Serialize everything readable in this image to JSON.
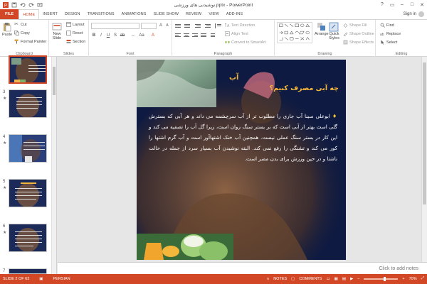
{
  "window": {
    "title": "نوشیدنی های ورزشی.pptx - PowerPoint",
    "signin": "Sign in"
  },
  "tabs": [
    "FILE",
    "HOME",
    "INSERT",
    "DESIGN",
    "TRANSITIONS",
    "ANIMATIONS",
    "SLIDE SHOW",
    "REVIEW",
    "VIEW",
    "ADD-INS"
  ],
  "ribbon": {
    "clipboard": {
      "label": "Clipboard",
      "paste": "Paste",
      "cut": "Cut",
      "copy": "Copy",
      "format_painter": "Format Painter"
    },
    "slides": {
      "label": "Slides",
      "new_slide_1": "New",
      "new_slide_2": "Slide",
      "layout": "Layout",
      "reset": "Reset",
      "section": "Section"
    },
    "font": {
      "label": "Font"
    },
    "paragraph": {
      "label": "Paragraph",
      "text_direction": "Text Direction",
      "align_text": "Align Text",
      "convert_smartart": "Convert to SmartArt"
    },
    "drawing": {
      "label": "Drawing",
      "arrange": "Arrange",
      "quick_styles_1": "Quick",
      "quick_styles_2": "Styles",
      "shape_fill": "Shape Fill",
      "shape_outline": "Shape Outline",
      "shape_effects": "Shape Effects"
    },
    "editing": {
      "label": "Editing",
      "find": "Find",
      "replace": "Replace",
      "select": "Select"
    }
  },
  "thumbnails": [
    {
      "num": "",
      "selected": true
    },
    {
      "num": "3",
      "selected": false
    },
    {
      "num": "4",
      "selected": false
    },
    {
      "num": "5",
      "selected": false
    },
    {
      "num": "6",
      "selected": false
    },
    {
      "num": "7",
      "selected": false
    }
  ],
  "slide": {
    "heading": "آب",
    "title": "چه آبی مصرف کنیم؟",
    "body": "ابوعلی سینا آب جاری را مطلوب تر از آب سرچشمه می داند و هر آبی که بسترش گلی است بهتر از آبی است که بر بستر سنگ روان است، زیرا گل آب را تصفیه می کند و این کار در بستر سنگ عملی نیست. همچنین آب خنک اشتهاآور است و آب گرم اشتها را کور می کند و تشنگی را رفع نمی کند. البته نوشیدن آب بسیار سرد از جمله در حالت ناشتا و در حین ورزش برای بدن مضر است."
  },
  "notes": {
    "placeholder": "Click to add notes"
  },
  "status": {
    "slide": "SLIDE 2 OF 63",
    "language": "PERSIAN",
    "notes": "NOTES",
    "comments": "COMMENTS",
    "zoom": "70%"
  },
  "colors": {
    "accent": "#d24726",
    "slide_bg": "#0e1a42",
    "title": "#f2b53b"
  }
}
